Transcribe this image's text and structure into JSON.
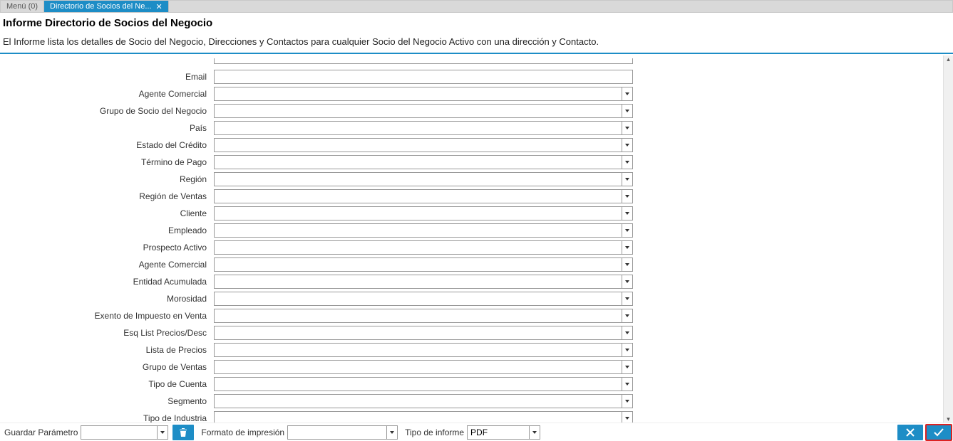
{
  "tabs": {
    "menu": "Menú (0)",
    "active": "Directorio de Socios del Ne..."
  },
  "header": {
    "title": "Informe Directorio de Socios del Negocio",
    "description": "El Informe lista los detalles de Socio del Negocio, Direcciones y Contactos para cualquier Socio del Negocio Activo con una dirección y Contacto."
  },
  "fields": [
    {
      "label": "Email",
      "type": "text",
      "value": ""
    },
    {
      "label": "Agente Comercial",
      "type": "combo",
      "value": ""
    },
    {
      "label": "Grupo de Socio del Negocio",
      "type": "combo",
      "value": ""
    },
    {
      "label": "País",
      "type": "combo",
      "value": ""
    },
    {
      "label": "Estado del Crédito",
      "type": "combo",
      "value": ""
    },
    {
      "label": "Término de Pago",
      "type": "combo",
      "value": ""
    },
    {
      "label": "Región",
      "type": "combo",
      "value": ""
    },
    {
      "label": "Región de Ventas",
      "type": "combo",
      "value": ""
    },
    {
      "label": "Cliente",
      "type": "combo",
      "value": ""
    },
    {
      "label": "Empleado",
      "type": "combo",
      "value": ""
    },
    {
      "label": "Prospecto Activo",
      "type": "combo",
      "value": ""
    },
    {
      "label": "Agente Comercial",
      "type": "combo",
      "value": ""
    },
    {
      "label": "Entidad Acumulada",
      "type": "combo",
      "value": ""
    },
    {
      "label": "Morosidad",
      "type": "combo",
      "value": ""
    },
    {
      "label": "Exento de Impuesto en Venta",
      "type": "combo",
      "value": ""
    },
    {
      "label": "Esq List Precios/Desc",
      "type": "combo",
      "value": ""
    },
    {
      "label": "Lista de Precios",
      "type": "combo",
      "value": ""
    },
    {
      "label": "Grupo de Ventas",
      "type": "combo",
      "value": ""
    },
    {
      "label": "Tipo de Cuenta",
      "type": "combo",
      "value": ""
    },
    {
      "label": "Segmento",
      "type": "combo",
      "value": ""
    },
    {
      "label": "Tipo de Industria",
      "type": "combo",
      "value": ""
    }
  ],
  "bottom": {
    "save_param_label": "Guardar Parámetro",
    "save_param_value": "",
    "print_format_label": "Formato de impresión",
    "print_format_value": "",
    "report_type_label": "Tipo de informe",
    "report_type_value": "PDF"
  }
}
